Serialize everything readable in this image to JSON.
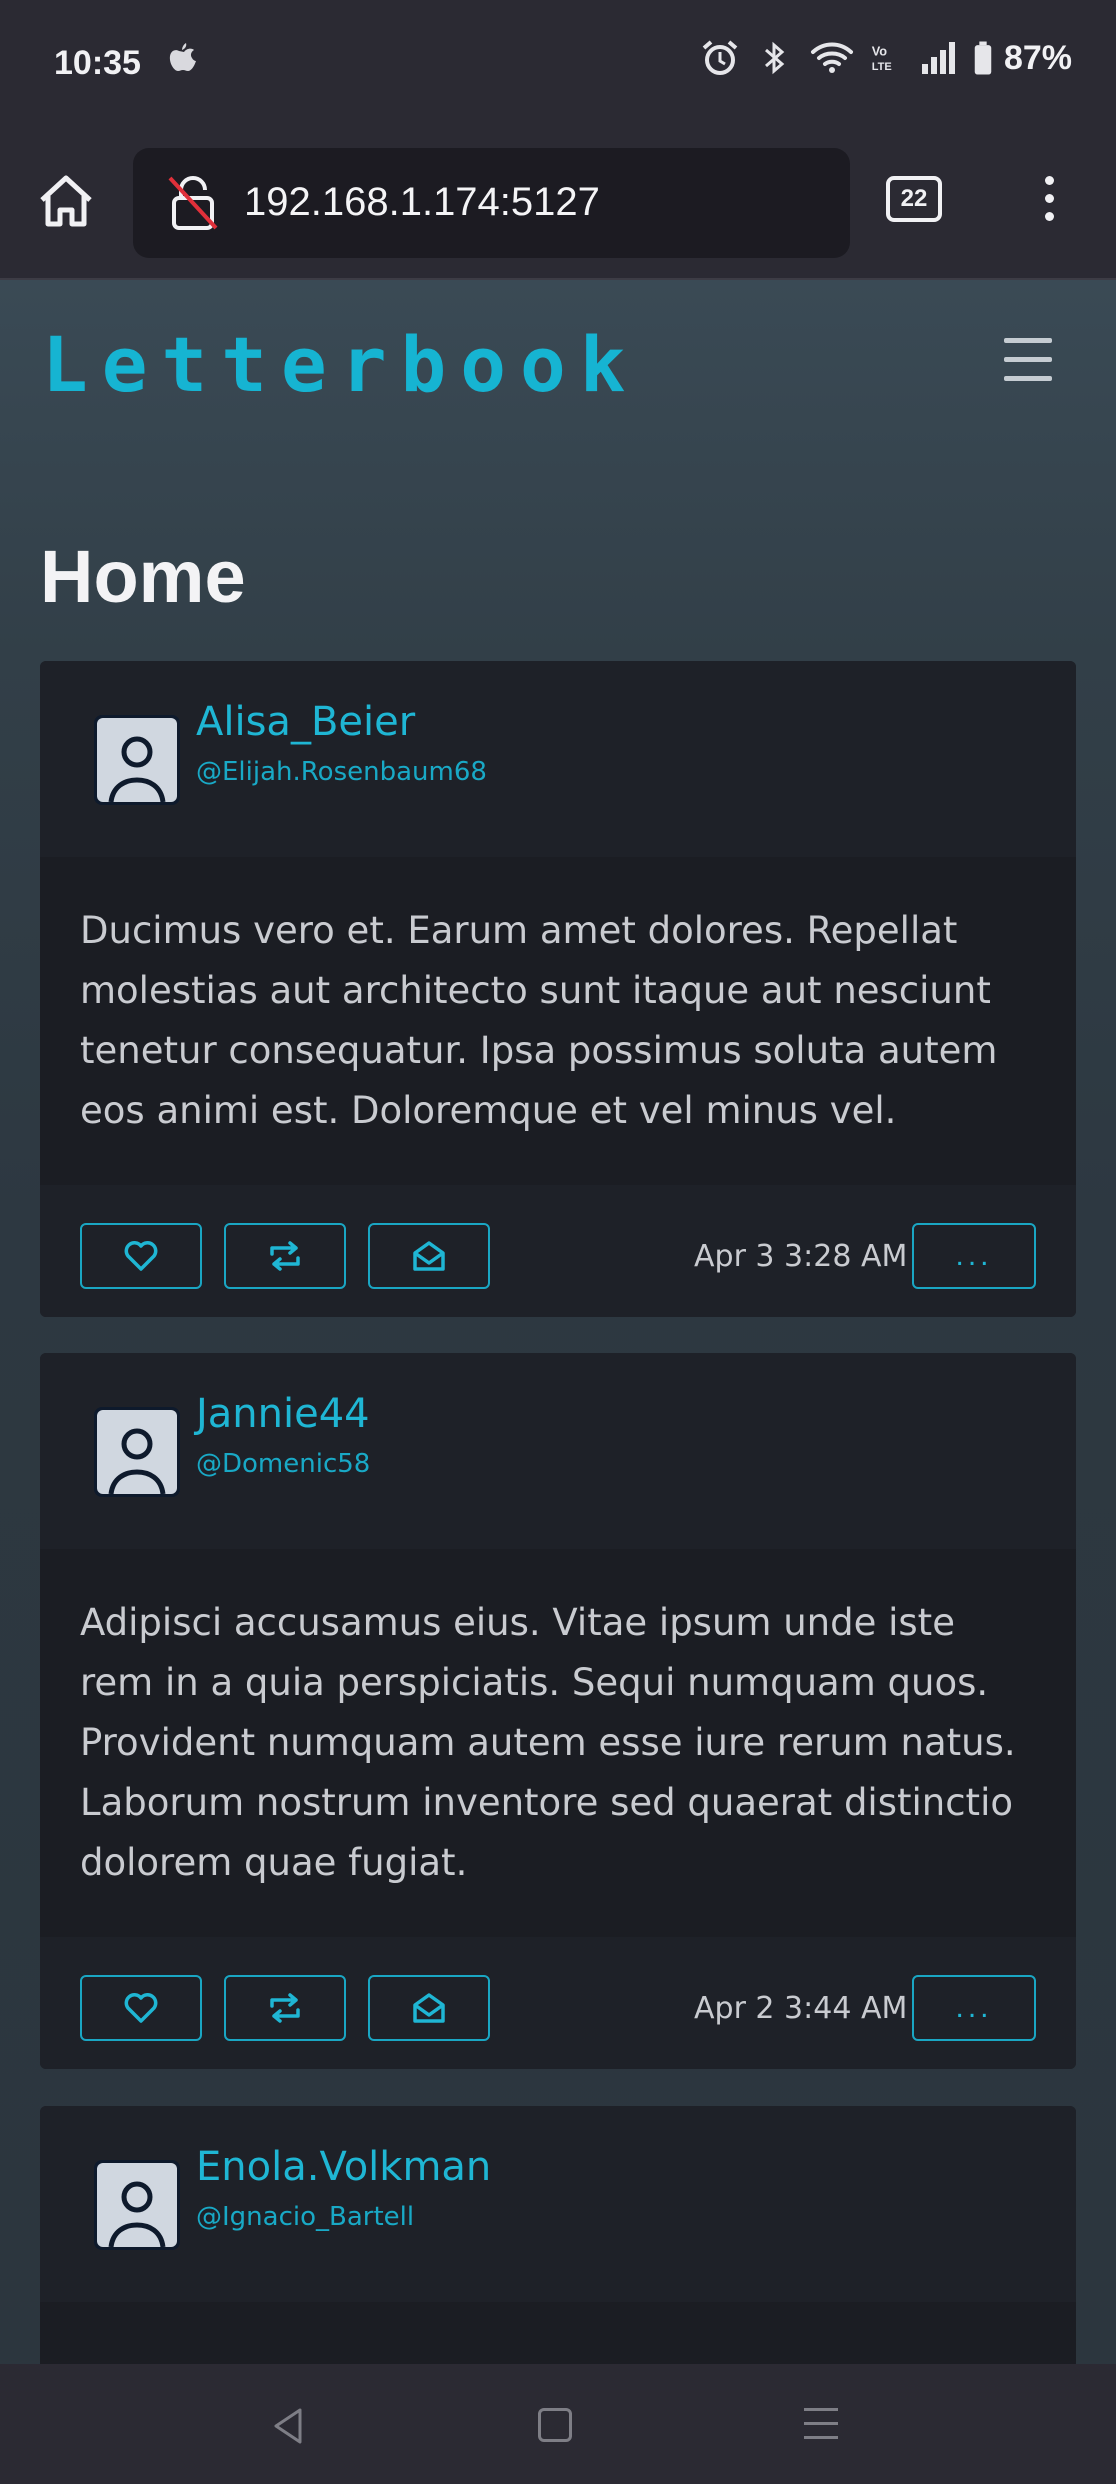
{
  "status_bar": {
    "time": "10:35",
    "battery": "87%",
    "network": "LTE"
  },
  "browser": {
    "url": "192.168.1.174:5127",
    "tab_count": "22"
  },
  "app": {
    "brand": "Letterbook",
    "page_title": "Home"
  },
  "posts": [
    {
      "display_name": "Alisa_Beier",
      "handle": "@Elijah.Rosenbaum68",
      "body": "Ducimus vero et. Earum amet dolores. Repellat molestias aut architecto sunt itaque aut nesciunt tenetur consequatur. Ipsa possimus soluta autem eos animi est. Doloremque et vel minus vel.",
      "timestamp": "Apr 3 3:28 AM",
      "more_label": "..."
    },
    {
      "display_name": "Jannie44",
      "handle": "@Domenic58",
      "body": "Adipisci accusamus eius. Vitae ipsum unde iste rem in a quia perspiciatis. Sequi numquam quos. Provident numquam autem esse iure rerum natus. Laborum nostrum inventore sed quaerat distinctio dolorem quae fugiat.",
      "timestamp": "Apr 2 3:44 AM",
      "more_label": "..."
    },
    {
      "display_name": "Enola.Volkman",
      "handle": "@Ignacio_Bartell"
    }
  ],
  "colors": {
    "accent": "#16b4d2",
    "card_bg": "#1d2027",
    "page_bg": "#2f3b44",
    "chrome_bg": "#2b2a33"
  },
  "icons": [
    "apple-icon",
    "alarm-icon",
    "bluetooth-icon",
    "wifi-icon",
    "signal-icon",
    "battery-icon",
    "home-icon",
    "insecure-lock-icon",
    "tabs-icon",
    "overflow-menu-icon",
    "hamburger-icon",
    "avatar-icon",
    "heart-icon",
    "boost-icon",
    "reply-icon",
    "back-icon",
    "recents-icon"
  ]
}
